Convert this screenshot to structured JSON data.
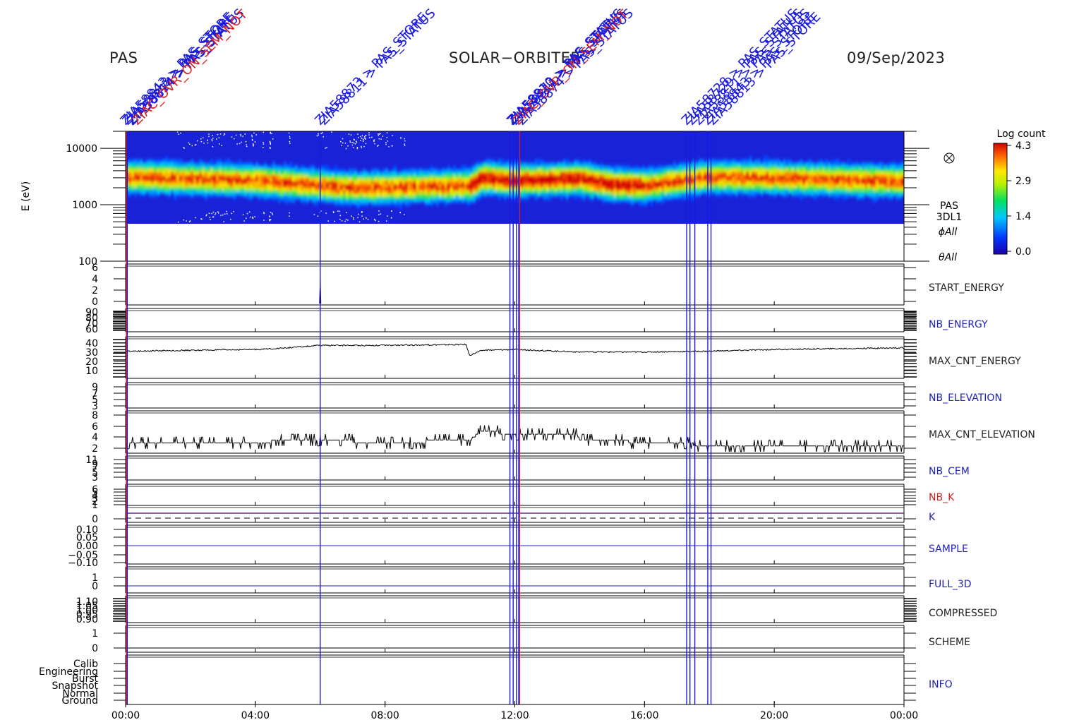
{
  "header": {
    "instrument": "PAS",
    "mission": "SOLAR−ORBITER",
    "date": "09/Sep/2023"
  },
  "colorbar": {
    "title": "Log count",
    "ticks": [
      "4.3",
      "2.9",
      "1.4",
      "0.0"
    ]
  },
  "spectrogram_labels": [
    "PAS",
    "3DL1",
    "ϕAll",
    "θAll"
  ],
  "time_ticks": [
    "00:00",
    "04:00",
    "08:00",
    "12:00",
    "16:00",
    "20:00",
    "00:00"
  ],
  "colors": {
    "event_blue": "#1a1adf",
    "event_red": "#d92020",
    "label_blue": "#2222bb",
    "label_red": "#cc2222"
  },
  "events": {
    "blue": [
      0.05,
      6.0,
      11.85,
      11.95,
      12.05,
      12.12,
      17.3,
      17.4,
      17.55,
      17.95,
      18.05
    ],
    "red": [
      0.02,
      12.15
    ],
    "labels": [
      {
        "t": 0.0,
        "text": "ZIA58843 > PAS_STORE",
        "color": "blue"
      },
      {
        "t": 0.0,
        "text": "ZIA58813 > PAS_STORE",
        "color": "blue"
      },
      {
        "t": 0.1,
        "text": "ZIA58874 > PAS_STATUS",
        "color": "blue"
      },
      {
        "t": 0.2,
        "text": "ZIA58814 > PAS_STAT",
        "color": "blue"
      },
      {
        "t": 0.3,
        "text": "ZIAC_OVR_ON_SEM_NOT",
        "color": "red"
      },
      {
        "t": 6.0,
        "text": "ZIA58811 > PAS_STATUS",
        "color": "blue"
      },
      {
        "t": 6.0,
        "text": "ZIA58873 > PAS_STORE",
        "color": "blue"
      },
      {
        "t": 11.85,
        "text": "ZIA58810 > PAS_STATUS",
        "color": "blue"
      },
      {
        "t": 11.9,
        "text": "ZIA58811 > PAS_STATUS",
        "color": "blue"
      },
      {
        "t": 11.95,
        "text": "ZIA58873 > PAS_STORE",
        "color": "blue"
      },
      {
        "t": 12.05,
        "text": "ZIAC_OVR_ON_SEM_NOT",
        "color": "red"
      },
      {
        "t": 12.1,
        "text": "ZIA58874 > PAS_STATUS",
        "color": "blue"
      },
      {
        "t": 17.3,
        "text": "ZIA58728 > PAS_STATUS",
        "color": "blue"
      },
      {
        "t": 17.4,
        "text": "ZIA58729 > PAS_STATUS",
        "color": "blue"
      },
      {
        "t": 17.55,
        "text": "ZIA58811 > PAS_STATUS",
        "color": "blue"
      },
      {
        "t": 17.95,
        "text": "ZIA58843 > PAS_STORE",
        "color": "blue"
      },
      {
        "t": 18.05,
        "text": "ZIA58813 > PAS_STORE",
        "color": "blue"
      }
    ]
  },
  "chart_data": {
    "type": "heatmap",
    "title": "SOLAR−ORBITER",
    "x_range": [
      "00:00",
      "24:00"
    ],
    "spectrogram": {
      "ylabel": "E (eV)",
      "yscale": "log",
      "ylim": [
        100,
        20000
      ],
      "yticks": [
        "10000",
        "1000",
        "100"
      ],
      "colorbar": "Log count",
      "zlim": [
        0.0,
        4.3
      ],
      "peak_energy_ev": {
        "t": [
          0,
          2,
          4,
          5.5,
          7,
          9,
          10.6,
          11,
          12,
          14,
          15,
          16,
          18,
          20,
          22,
          24
        ],
        "values": [
          3100,
          2900,
          2700,
          2300,
          2000,
          2100,
          2200,
          3000,
          2700,
          2900,
          2300,
          2200,
          3100,
          3000,
          2800,
          2600
        ]
      }
    },
    "panels": [
      {
        "label": "START_ENERGY",
        "label_color": "black",
        "yticks": [
          "6",
          "4",
          "2",
          "0"
        ],
        "ylim": [
          0,
          6
        ],
        "series": {
          "t": [
            5.98,
            6.0,
            6.02
          ],
          "values": [
            0,
            4,
            0
          ]
        }
      },
      {
        "label": "NB_ENERGY",
        "label_color": "blue",
        "yticks": [
          "90",
          "80",
          "70",
          "60"
        ],
        "ylim": [
          60,
          90
        ]
      },
      {
        "label": "MAX_CNT_ENERGY",
        "label_color": "black",
        "yticks": [
          "40",
          "30",
          "20",
          "10"
        ],
        "ylim": [
          0,
          45
        ],
        "series": {
          "t": [
            0,
            2,
            4,
            5,
            6,
            8,
            10.5,
            10.6,
            11,
            12,
            14,
            16,
            18,
            20,
            22,
            24
          ],
          "values": [
            31,
            32,
            33,
            35,
            38,
            38,
            39,
            26,
            32,
            33,
            30,
            30,
            31,
            33,
            34,
            35
          ]
        }
      },
      {
        "label": "NB_ELEVATION",
        "label_color": "blue",
        "yticks": [
          "9",
          "7",
          "5",
          "3"
        ],
        "ylim": [
          3,
          9
        ]
      },
      {
        "label": "MAX_CNT_ELEVATION",
        "label_color": "black",
        "yticks": [
          "8",
          "6",
          "4",
          "2"
        ],
        "ylim": [
          2,
          8.5
        ],
        "series": {
          "t": [
            0,
            3,
            6,
            8,
            10.6,
            11,
            12,
            13.9,
            14,
            17,
            18,
            24
          ],
          "values": [
            3.5,
            3.5,
            4,
            3.5,
            4,
            5.5,
            5,
            5,
            4,
            3.5,
            3,
            3
          ]
        }
      },
      {
        "label": "NB_CEM",
        "label_color": "blue",
        "yticks": [
          "11",
          "9",
          "7",
          "5",
          "3"
        ],
        "ylim": [
          3,
          11
        ]
      },
      {
        "label": "NB_K",
        "label_color": "red",
        "yticks": [
          "6",
          "5",
          "4",
          "3",
          "2",
          "1",
          "0"
        ],
        "ylim": [
          0,
          6
        ]
      },
      {
        "label": "K",
        "label_color": "blue"
      },
      {
        "label": "SAMPLE",
        "label_color": "blue",
        "yticks": [
          "0.10",
          "0.05",
          "0.00",
          "−0.05",
          "−0.10"
        ],
        "ylim": [
          -0.1,
          0.1
        ]
      },
      {
        "label": "FULL_3D",
        "label_color": "blue",
        "yticks": [
          "1",
          "0"
        ],
        "ylim": [
          0,
          1
        ]
      },
      {
        "label": "COMPRESSED",
        "label_color": "black",
        "yticks": [
          "1.10",
          "1.05",
          "1.00",
          "0.95",
          "0.90"
        ],
        "ylim": [
          0.9,
          1.1
        ]
      },
      {
        "label": "SCHEME",
        "label_color": "black",
        "yticks": [
          "1",
          "0"
        ],
        "ylim": [
          0,
          1
        ]
      },
      {
        "label": "INFO",
        "label_color": "blue",
        "yticks": [
          "Calib",
          "Engineering",
          "Burst",
          "Snapshot",
          "Normal",
          "Ground"
        ]
      }
    ]
  }
}
